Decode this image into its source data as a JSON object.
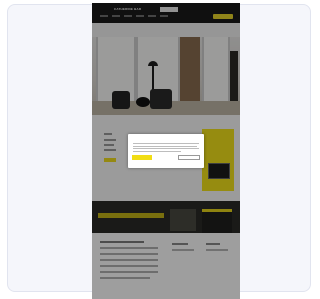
{
  "header": {
    "logo": "CATHERINE BAR",
    "phone": "",
    "nav_links": [
      "",
      "",
      "",
      "",
      "",
      ""
    ],
    "cta_label": ""
  },
  "hero": {
    "caption": ""
  },
  "cookie_modal": {
    "title": "",
    "accept_label": "",
    "decline_label": "",
    "preferences_label": "",
    "policy_link": ""
  },
  "colors": {
    "accent": "#f0de1e",
    "dark": "#1b1b1b",
    "overlay": "rgba(0,0,0,0.38)"
  }
}
